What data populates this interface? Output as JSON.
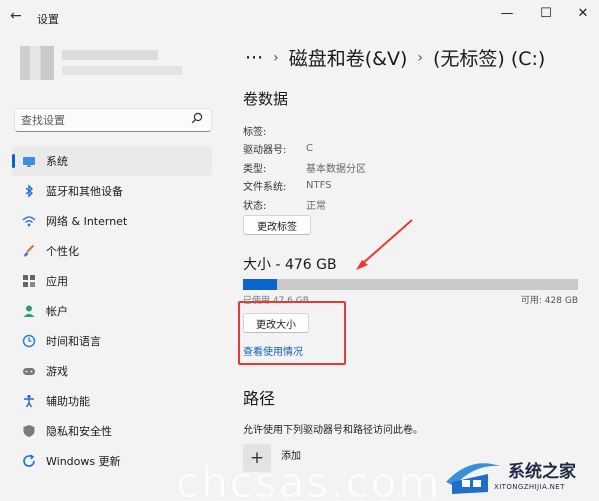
{
  "window": {
    "title": "设置",
    "back": "←",
    "minimize": "—",
    "maximize": "☐",
    "close": "✕"
  },
  "search": {
    "placeholder": "查找设置"
  },
  "nav": [
    {
      "label": "系统",
      "icon": "monitor-icon",
      "selected": true
    },
    {
      "label": "蓝牙和其他设备",
      "icon": "bluetooth-icon"
    },
    {
      "label": "网络 & Internet",
      "icon": "wifi-icon"
    },
    {
      "label": "个性化",
      "icon": "brush-icon"
    },
    {
      "label": "应用",
      "icon": "apps-icon"
    },
    {
      "label": "帐户",
      "icon": "person-icon"
    },
    {
      "label": "时间和语言",
      "icon": "clock-globe-icon"
    },
    {
      "label": "游戏",
      "icon": "gamepad-icon"
    },
    {
      "label": "辅助功能",
      "icon": "accessibility-icon"
    },
    {
      "label": "隐私和安全性",
      "icon": "shield-icon"
    },
    {
      "label": "Windows 更新",
      "icon": "update-icon"
    }
  ],
  "breadcrumb": {
    "ellipsis": "···",
    "sep": "›",
    "item1": "磁盘和卷(&V)",
    "item2": "(无标签) (C:)"
  },
  "volume": {
    "title": "卷数据",
    "props": [
      {
        "key": "标签:",
        "value": ""
      },
      {
        "key": "驱动器号:",
        "value": "C"
      },
      {
        "key": "类型:",
        "value": "基本数据分区"
      },
      {
        "key": "文件系统:",
        "value": "NTFS"
      },
      {
        "key": "状态:",
        "value": "正常"
      }
    ],
    "change_label_button": "更改标签"
  },
  "size": {
    "heading": "大小 - 476 GB",
    "used": "已使用 47.6 GB",
    "free": "可用: 428 GB",
    "used_fraction": 0.1,
    "resize_button": "更改大小",
    "view_usage_link": "查看使用情况"
  },
  "path": {
    "title": "路径",
    "description": "允许使用下列驱动器号和路径访问此卷。",
    "add_label": "添加",
    "add_symbol": "+"
  },
  "watermark": {
    "text": "chcsas.com",
    "cn": "系统之家",
    "en": "XITONGZHIJIA.NET"
  },
  "colors": {
    "accent": "#0a66cc",
    "highlight": "#e53935",
    "background": "#f3f3f3"
  }
}
